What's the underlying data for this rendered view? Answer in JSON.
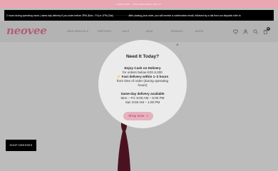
{
  "promo_bar": {
    "text": "4,000 4,500 · ASAP DELIVERY ON ALL"
  },
  "ticker": {
    "text": "2 hours during operating hours | same-day delivery if you order before 3PM (Mon - Fri) or 1PM (Sat) · · · · · · · · · · After placing your order, you will receive a confirmation email, followed by a call from our dispatch rider to"
  },
  "header": {
    "logo": "neovee",
    "nav": [
      "NEW ARRIVALS",
      "DRESSES",
      "SALE",
      "NEW",
      "BRANDS",
      "MORE"
    ],
    "cart_count": "0"
  },
  "hero": {
    "cta": "SHOP DRESSES"
  },
  "popup": {
    "close": "×",
    "title": "Need It Today?",
    "line1": "Enjoy Cash on Delivery",
    "line2": "for orders below KSh 6,000",
    "line3": "⚡ Fast delivery within 1–2 hours",
    "line4": "from time of order (during operating",
    "line5": "hours)",
    "line6": "Same-day delivery available",
    "line7": "Mon – Fri: 9:00 AM – 5:00 PM",
    "line8": "Sat: 9:00 AM – 1:00 PM",
    "button": "Shop Now",
    "button_arrow": "»"
  },
  "colors": {
    "accent": "#b15f74",
    "promo": "#e9a6b3",
    "button_bg": "#e8b1bf"
  },
  "icons": [
    "heart-icon",
    "user-icon",
    "search-icon",
    "cart-icon"
  ]
}
